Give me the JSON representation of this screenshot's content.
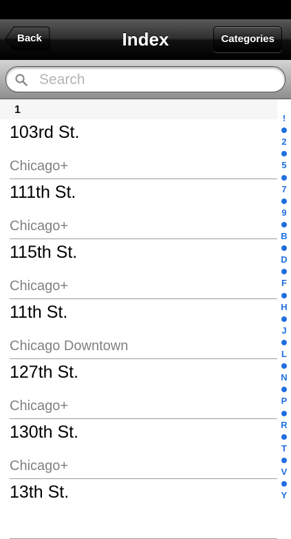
{
  "navbar": {
    "back_label": "Back",
    "title": "Index",
    "categories_label": "Categories"
  },
  "search": {
    "placeholder": "Search",
    "value": "",
    "icon": "magnifier-icon"
  },
  "section": {
    "header": "1"
  },
  "rows": [
    {
      "name": "103rd St.",
      "sub": "Chicago+"
    },
    {
      "name": "111th St.",
      "sub": "Chicago+"
    },
    {
      "name": "115th St.",
      "sub": "Chicago+"
    },
    {
      "name": "11th St.",
      "sub": "Chicago Downtown"
    },
    {
      "name": "127th St.",
      "sub": "Chicago+"
    },
    {
      "name": "130th St.",
      "sub": "Chicago+"
    },
    {
      "name": "13th St.",
      "sub": ""
    }
  ],
  "index": [
    "!",
    "•",
    "2",
    "•",
    "5",
    "•",
    "7",
    "•",
    "9",
    "•",
    "B",
    "•",
    "D",
    "•",
    "F",
    "•",
    "H",
    "•",
    "J",
    "•",
    "L",
    "•",
    "N",
    "•",
    "P",
    "•",
    "R",
    "•",
    "T",
    "•",
    "V",
    "•",
    "Y"
  ],
  "colors": {
    "index_accent": "#1f6fe0",
    "subtitle_gray": "#808080"
  }
}
